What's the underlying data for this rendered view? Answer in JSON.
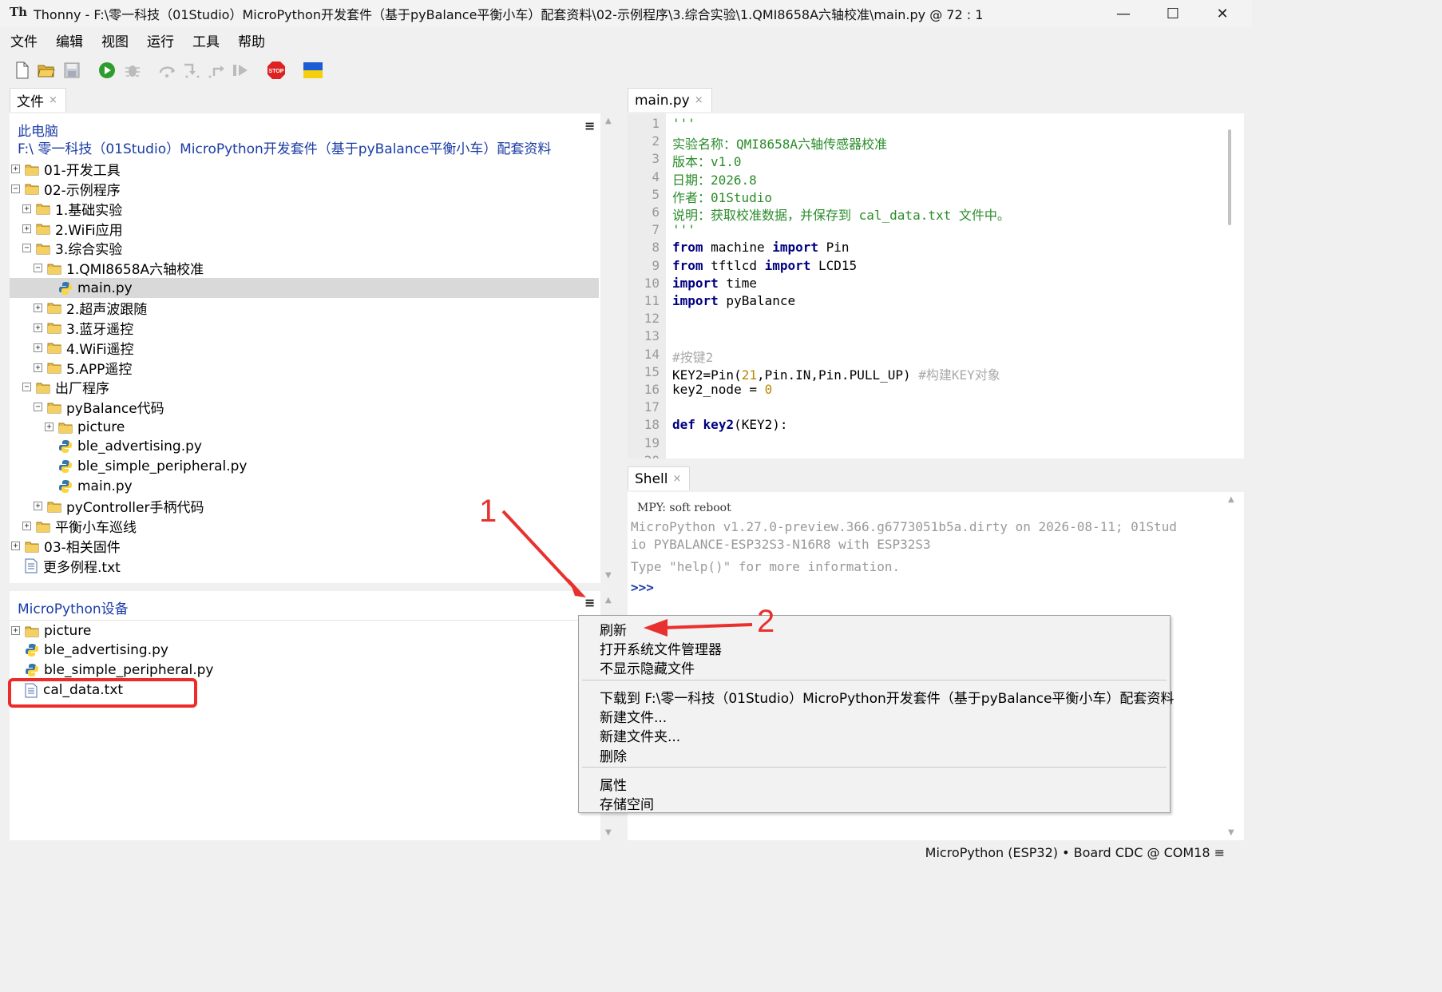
{
  "window": {
    "title": "Thonny  -  F:\\零一科技（01Studio）MicroPython开发套件（基于pyBalance平衡小车）配套资料\\02-示例程序\\3.综合实验\\1.QMI8658A六轴校准\\main.py  @  72 : 1",
    "icon_text": "Th",
    "minimize": "—",
    "maximize": "☐",
    "close": "✕"
  },
  "menubar": [
    "文件",
    "编辑",
    "视图",
    "运行",
    "工具",
    "帮助"
  ],
  "toolbar": {
    "buttons": [
      "new-file-icon",
      "open-folder-icon",
      "save-icon",
      "run-icon",
      "debug-icon",
      "step-over-icon",
      "step-into-icon",
      "step-out-icon",
      "resume-icon",
      "stop-icon",
      "ukraine-flag-icon"
    ],
    "stop_label": "STOP"
  },
  "files_tab": {
    "label": "文件",
    "close": "×"
  },
  "files_panel": {
    "title": "此电脑",
    "path": "F:\\ 零一科技（01Studio）MicroPython开发套件（基于pyBalance平衡小车）配套资料",
    "menu_icon": "≡",
    "tree": [
      {
        "label": "01-开发工具",
        "type": "folder",
        "depth": 0,
        "expander": "+"
      },
      {
        "label": "02-示例程序",
        "type": "folder",
        "depth": 0,
        "expander": "−"
      },
      {
        "label": "1.基础实验",
        "type": "folder",
        "depth": 1,
        "expander": "+"
      },
      {
        "label": "2.WiFi应用",
        "type": "folder",
        "depth": 1,
        "expander": "+"
      },
      {
        "label": "3.综合实验",
        "type": "folder",
        "depth": 1,
        "expander": "−"
      },
      {
        "label": "1.QMI8658A六轴校准",
        "type": "folder",
        "depth": 2,
        "expander": "−"
      },
      {
        "label": "main.py",
        "type": "py",
        "depth": 3,
        "expander": "",
        "selected": true
      },
      {
        "label": "2.超声波跟随",
        "type": "folder",
        "depth": 2,
        "expander": "+"
      },
      {
        "label": "3.蓝牙遥控",
        "type": "folder",
        "depth": 2,
        "expander": "+"
      },
      {
        "label": "4.WiFi遥控",
        "type": "folder",
        "depth": 2,
        "expander": "+"
      },
      {
        "label": "5.APP遥控",
        "type": "folder",
        "depth": 2,
        "expander": "+"
      },
      {
        "label": "出厂程序",
        "type": "folder",
        "depth": 1,
        "expander": "−"
      },
      {
        "label": "pyBalance代码",
        "type": "folder",
        "depth": 2,
        "expander": "−"
      },
      {
        "label": "picture",
        "type": "folder",
        "depth": 3,
        "expander": "+"
      },
      {
        "label": "ble_advertising.py",
        "type": "py",
        "depth": 3,
        "expander": ""
      },
      {
        "label": "ble_simple_peripheral.py",
        "type": "py",
        "depth": 3,
        "expander": ""
      },
      {
        "label": "main.py",
        "type": "py",
        "depth": 3,
        "expander": ""
      },
      {
        "label": "pyController手柄代码",
        "type": "folder",
        "depth": 2,
        "expander": "+"
      },
      {
        "label": "平衡小车巡线",
        "type": "folder",
        "depth": 1,
        "expander": "+"
      },
      {
        "label": "03-相关固件",
        "type": "folder",
        "depth": 0,
        "expander": "+"
      },
      {
        "label": "更多例程.txt",
        "type": "txt",
        "depth": 0,
        "expander": ""
      }
    ]
  },
  "device_panel": {
    "title": "MicroPython设备",
    "menu_icon": "≡",
    "tree": [
      {
        "label": "picture",
        "type": "folder",
        "depth": 0,
        "expander": "+"
      },
      {
        "label": "ble_advertising.py",
        "type": "py",
        "depth": 0,
        "expander": ""
      },
      {
        "label": "ble_simple_peripheral.py",
        "type": "py",
        "depth": 0,
        "expander": ""
      },
      {
        "label": "cal_data.txt",
        "type": "txt",
        "depth": 0,
        "expander": ""
      }
    ]
  },
  "editor_tab": {
    "label": "main.py",
    "close": "×"
  },
  "editor": {
    "lines": [
      [
        {
          "t": "'''",
          "c": "str"
        }
      ],
      [
        {
          "t": "实验名称：QMI8658A六轴传感器校准",
          "c": "str"
        }
      ],
      [
        {
          "t": "版本：v1.0",
          "c": "str"
        }
      ],
      [
        {
          "t": "日期：2026.8",
          "c": "str"
        }
      ],
      [
        {
          "t": "作者：01Studio",
          "c": "str"
        }
      ],
      [
        {
          "t": "说明：获取校准数据，并保存到 cal_data.txt 文件中。",
          "c": "str"
        }
      ],
      [
        {
          "t": "'''",
          "c": "str"
        }
      ],
      [
        {
          "t": "from",
          "c": "kw"
        },
        {
          "t": " machine ",
          "c": ""
        },
        {
          "t": "import",
          "c": "kw"
        },
        {
          "t": " Pin",
          "c": ""
        }
      ],
      [
        {
          "t": "from",
          "c": "kw"
        },
        {
          "t": " tftlcd ",
          "c": ""
        },
        {
          "t": "import",
          "c": "kw"
        },
        {
          "t": " LCD15",
          "c": ""
        }
      ],
      [
        {
          "t": "import",
          "c": "kw"
        },
        {
          "t": " time",
          "c": ""
        }
      ],
      [
        {
          "t": "import",
          "c": "kw"
        },
        {
          "t": " pyBalance",
          "c": ""
        }
      ],
      [],
      [],
      [
        {
          "t": "#按键2",
          "c": "cm"
        }
      ],
      [
        {
          "t": "KEY2=Pin(",
          "c": ""
        },
        {
          "t": "21",
          "c": "num"
        },
        {
          "t": ",Pin.IN,Pin.PULL_UP) ",
          "c": ""
        },
        {
          "t": "#构建KEY对象",
          "c": "cm"
        }
      ],
      [
        {
          "t": "key2_node = ",
          "c": ""
        },
        {
          "t": "0",
          "c": "num"
        }
      ],
      [],
      [
        {
          "t": "def",
          "c": "kw"
        },
        {
          "t": " ",
          "c": ""
        },
        {
          "t": "key2",
          "c": "kw"
        },
        {
          "t": "(KEY2):",
          "c": ""
        }
      ],
      [],
      []
    ]
  },
  "shell_tab": {
    "label": "Shell",
    "close": "×"
  },
  "shell": {
    "lines": [
      "MPY: soft reboot",
      "MicroPython v1.27.0-preview.366.g6773051b5a.dirty on 2026-08-11; 01Stud",
      "io PYBALANCE-ESP32S3-N16R8 with ESP32S3",
      "Type \"help()\" for more information.",
      ">>>"
    ]
  },
  "context_menu": {
    "group1": [
      "刷新",
      "打开系统文件管理器",
      "不显示隐藏文件"
    ],
    "group2": [
      "下载到 F:\\零一科技（01Studio）MicroPython开发套件（基于pyBalance平衡小车）配套资料",
      "新建文件...",
      "新建文件夹...",
      "删除"
    ],
    "group3": [
      "属性",
      "存储空间"
    ]
  },
  "annotations": {
    "label1": "1",
    "label2": "2"
  },
  "statusbar": {
    "text": "MicroPython (ESP32)  •  Board CDC @ COM18  ≡"
  },
  "colors": {
    "accent_title": "#1a3ca6",
    "annotation": "#e8312f",
    "string": "#2a8c2a",
    "keyword": "#000080"
  }
}
